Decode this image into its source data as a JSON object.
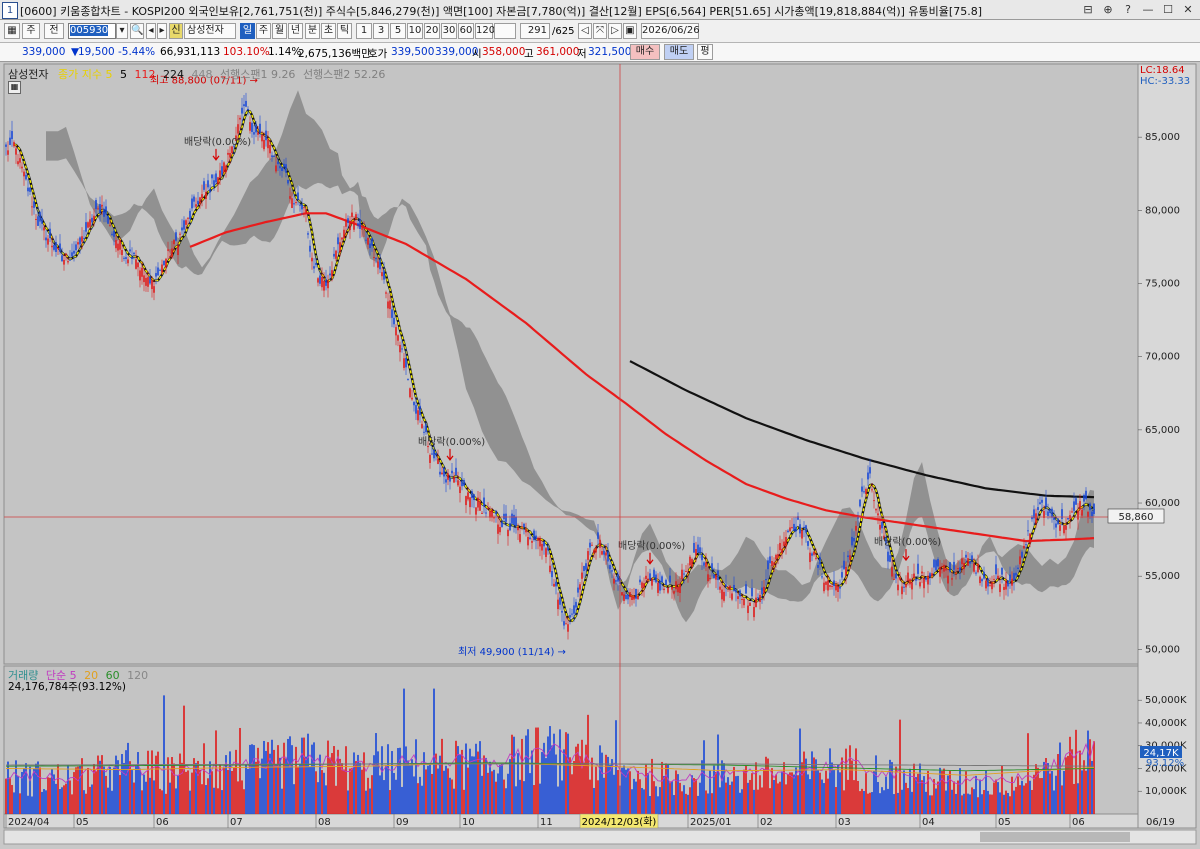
{
  "window": {
    "number": "1",
    "title": "[0600] 키움종합차트 - KOSPI200 외국인보유[2,761,751(천)] 주식수[5,846,279(천)] 액면[100] 자본금[7,780(억)] 결산[12월] EPS[6,564] PER[51.65] 시가총액[19,818,884(억)] 유통비율[75.8]",
    "controls": [
      "⊟",
      "⊕",
      "?",
      "—",
      "☐",
      "✕"
    ]
  },
  "toolbar": {
    "period_buttons": [
      "주",
      "전"
    ],
    "code_value": "005930",
    "stock_badge": "신",
    "stock_name": "삼성전자",
    "timeframes": [
      "일",
      "주",
      "월",
      "년",
      "분",
      "초",
      "틱"
    ],
    "selected_timeframe": "일",
    "intervals": [
      "1",
      "3",
      "5",
      "10",
      "20",
      "30",
      "60",
      "120"
    ],
    "count_value": "291",
    "count_total": "/625",
    "date_value": "2026/06/26"
  },
  "quote": {
    "price": "339,000",
    "change": "19,500",
    "change_pct": "-5.44%",
    "volume": "66,931,113",
    "vol_ratio": "103.10%",
    "turnover": "1.14%",
    "amount": "2,675,136백만",
    "ask_label": "호가",
    "ask1": "339,500",
    "ask2": "339,000",
    "open_label": "시",
    "open": "358,000",
    "high_label": "고",
    "high": "361,000",
    "low_label": "저",
    "low": "321,500",
    "buy_button": "매수",
    "sell_button": "매도",
    "eval_button": "평"
  },
  "price_panel": {
    "legend": {
      "name": "삼성전자",
      "indicator": "종가 지수 5",
      "ma": [
        "5",
        "112",
        "224",
        "448"
      ],
      "span1": "선행스팬1 9.26",
      "span2": "선행스팬2 52.26"
    },
    "lc": "LC:18.64",
    "hc": "HC:-33.33",
    "current_price_label": "58,860",
    "annotations": {
      "high": "최고 88,800 (07/11)",
      "low": "최저 49,900 (11/14)",
      "dividends": [
        "배당락(0.00%)",
        "배당락(0.00%)",
        "배당락(0.00%)",
        "배당락(0.00%)"
      ]
    },
    "y_ticks": [
      "85,000",
      "80,000",
      "75,000",
      "70,000",
      "65,000",
      "60,000",
      "55,000",
      "50,000"
    ]
  },
  "volume_panel": {
    "legend": {
      "name": "거래량",
      "ma_label": "단순 5",
      "ma": [
        "20",
        "60",
        "120"
      ]
    },
    "info": "24,176,784주(93.12%)",
    "current_label": "24,17K",
    "ratio_label": "93.12%",
    "y_ticks": [
      "50,000K",
      "40,000K",
      "30,000K",
      "20,000K",
      "10,000K"
    ]
  },
  "x_axis": {
    "labels": [
      "2024/04",
      "05",
      "06",
      "07",
      "08",
      "09",
      "10",
      "11",
      "2025/01",
      "02",
      "03",
      "04",
      "05",
      "06"
    ],
    "cursor_date": "2024/12/03(화)",
    "end_label": "06/19"
  },
  "colors": {
    "up": "#e01818",
    "down": "#1646d8",
    "ma5": "#f6ee00",
    "ma112": "#e81c1c",
    "ma224": "#111111",
    "cloud": "#808080",
    "cursor": "#d04040"
  },
  "chart_data": {
    "type": "candlestick",
    "price_range": [
      49000,
      90000
    ],
    "volume_range": [
      0,
      58000000
    ],
    "close_points": [
      [
        0,
        84200
      ],
      [
        4,
        84500
      ],
      [
        8,
        82800
      ],
      [
        12,
        81000
      ],
      [
        16,
        79200
      ],
      [
        20,
        78300
      ],
      [
        24,
        77500
      ],
      [
        28,
        76600
      ],
      [
        32,
        76900
      ],
      [
        36,
        77400
      ],
      [
        40,
        78600
      ],
      [
        44,
        79600
      ],
      [
        48,
        80300
      ],
      [
        52,
        78800
      ],
      [
        56,
        77800
      ],
      [
        60,
        76900
      ],
      [
        64,
        77200
      ],
      [
        68,
        75800
      ],
      [
        72,
        74900
      ],
      [
        76,
        75600
      ],
      [
        80,
        76700
      ],
      [
        84,
        77600
      ],
      [
        88,
        78500
      ],
      [
        92,
        79600
      ],
      [
        96,
        80700
      ],
      [
        100,
        81200
      ],
      [
        104,
        82000
      ],
      [
        108,
        82600
      ],
      [
        112,
        84000
      ],
      [
        116,
        85700
      ],
      [
        120,
        87000
      ],
      [
        124,
        85400
      ],
      [
        128,
        85000
      ],
      [
        132,
        84300
      ],
      [
        136,
        83000
      ],
      [
        140,
        82700
      ],
      [
        142,
        81200
      ],
      [
        146,
        80300
      ],
      [
        150,
        79800
      ],
      [
        152,
        77200
      ],
      [
        156,
        75500
      ],
      [
        160,
        75200
      ],
      [
        164,
        76600
      ],
      [
        168,
        78400
      ],
      [
        172,
        79600
      ],
      [
        176,
        79200
      ],
      [
        180,
        78200
      ],
      [
        184,
        77000
      ],
      [
        188,
        75600
      ],
      [
        192,
        73600
      ],
      [
        196,
        71500
      ],
      [
        200,
        69200
      ],
      [
        204,
        66600
      ],
      [
        208,
        65300
      ],
      [
        212,
        63700
      ],
      [
        216,
        62600
      ],
      [
        220,
        61700
      ],
      [
        224,
        61600
      ],
      [
        228,
        61000
      ],
      [
        232,
        60300
      ],
      [
        236,
        60000
      ],
      [
        240,
        59500
      ],
      [
        244,
        59000
      ],
      [
        248,
        58600
      ],
      [
        252,
        58300
      ],
      [
        256,
        58200
      ],
      [
        260,
        58000
      ],
      [
        264,
        57700
      ],
      [
        268,
        57600
      ],
      [
        272,
        56000
      ],
      [
        276,
        53400
      ],
      [
        280,
        51500
      ],
      [
        284,
        52600
      ],
      [
        288,
        55000
      ],
      [
        292,
        56700
      ],
      [
        296,
        57400
      ],
      [
        300,
        56200
      ],
      [
        304,
        54800
      ],
      [
        308,
        54100
      ],
      [
        312,
        53600
      ],
      [
        316,
        54000
      ],
      [
        320,
        54600
      ],
      [
        324,
        54500
      ],
      [
        328,
        54300
      ],
      [
        332,
        54200
      ],
      [
        336,
        54600
      ],
      [
        340,
        55400
      ],
      [
        344,
        56500
      ],
      [
        348,
        56200
      ],
      [
        352,
        55300
      ],
      [
        356,
        54600
      ],
      [
        360,
        54200
      ],
      [
        364,
        54200
      ],
      [
        368,
        53800
      ],
      [
        372,
        53200
      ],
      [
        376,
        53400
      ],
      [
        380,
        55000
      ],
      [
        384,
        56200
      ],
      [
        388,
        57300
      ],
      [
        392,
        58400
      ],
      [
        396,
        58500
      ],
      [
        400,
        57700
      ],
      [
        404,
        56300
      ],
      [
        408,
        55100
      ],
      [
        412,
        54400
      ],
      [
        416,
        54300
      ],
      [
        420,
        55400
      ],
      [
        424,
        57700
      ],
      [
        428,
        60500
      ],
      [
        432,
        61600
      ],
      [
        436,
        59000
      ],
      [
        440,
        56800
      ],
      [
        444,
        55000
      ],
      [
        448,
        54500
      ],
      [
        452,
        55100
      ],
      [
        456,
        54800
      ],
      [
        460,
        55000
      ],
      [
        464,
        55400
      ],
      [
        468,
        55500
      ],
      [
        472,
        55100
      ],
      [
        476,
        55600
      ],
      [
        480,
        56000
      ],
      [
        484,
        55800
      ],
      [
        488,
        55100
      ],
      [
        492,
        54500
      ],
      [
        496,
        55000
      ],
      [
        500,
        54600
      ],
      [
        504,
        55100
      ],
      [
        508,
        56200
      ],
      [
        512,
        58300
      ],
      [
        516,
        59700
      ],
      [
        520,
        59600
      ],
      [
        524,
        58800
      ],
      [
        528,
        58600
      ],
      [
        532,
        58900
      ],
      [
        536,
        59800
      ],
      [
        540,
        60000
      ],
      [
        544,
        58900
      ]
    ],
    "ma112_points": [
      [
        92,
        77500
      ],
      [
        110,
        78500
      ],
      [
        130,
        79200
      ],
      [
        150,
        79800
      ],
      [
        160,
        79800
      ],
      [
        176,
        79000
      ],
      [
        200,
        77700
      ],
      [
        230,
        75300
      ],
      [
        260,
        72300
      ],
      [
        290,
        68800
      ],
      [
        310,
        66800
      ],
      [
        330,
        64700
      ],
      [
        350,
        62900
      ],
      [
        370,
        61300
      ],
      [
        390,
        60300
      ],
      [
        410,
        59500
      ],
      [
        430,
        59000
      ],
      [
        450,
        58600
      ],
      [
        470,
        58200
      ],
      [
        490,
        57800
      ],
      [
        510,
        57400
      ],
      [
        530,
        57500
      ],
      [
        544,
        57600
      ]
    ],
    "ma224_points": [
      [
        312,
        69700
      ],
      [
        340,
        67700
      ],
      [
        370,
        65800
      ],
      [
        400,
        64300
      ],
      [
        430,
        63000
      ],
      [
        460,
        61900
      ],
      [
        490,
        61000
      ],
      [
        520,
        60500
      ],
      [
        544,
        60400
      ]
    ],
    "volume_ma5": [
      [
        0,
        17000000
      ],
      [
        30,
        16000000
      ],
      [
        60,
        20000000
      ],
      [
        90,
        19000000
      ],
      [
        120,
        21000000
      ],
      [
        150,
        25000000
      ],
      [
        180,
        20000000
      ],
      [
        210,
        24000000
      ],
      [
        240,
        22000000
      ],
      [
        270,
        28000000
      ],
      [
        300,
        20000000
      ],
      [
        330,
        16000000
      ],
      [
        360,
        17000000
      ],
      [
        390,
        18000000
      ],
      [
        420,
        22000000
      ],
      [
        450,
        16000000
      ],
      [
        480,
        14000000
      ],
      [
        510,
        16000000
      ],
      [
        544,
        29000000
      ]
    ],
    "volume_ma20": [
      [
        0,
        20000000
      ],
      [
        60,
        19500000
      ],
      [
        120,
        20500000
      ],
      [
        180,
        21000000
      ],
      [
        240,
        22500000
      ],
      [
        300,
        21000000
      ],
      [
        360,
        19000000
      ],
      [
        420,
        19500000
      ],
      [
        480,
        17000000
      ],
      [
        544,
        20500000
      ]
    ],
    "volume_ma60": [
      [
        0,
        21000000
      ],
      [
        120,
        21500000
      ],
      [
        240,
        22500000
      ],
      [
        360,
        21500000
      ],
      [
        480,
        19000000
      ],
      [
        544,
        20000000
      ]
    ],
    "volume_ma120": [
      [
        0,
        21500000
      ],
      [
        180,
        22000000
      ],
      [
        360,
        22000000
      ],
      [
        544,
        21000000
      ]
    ]
  }
}
